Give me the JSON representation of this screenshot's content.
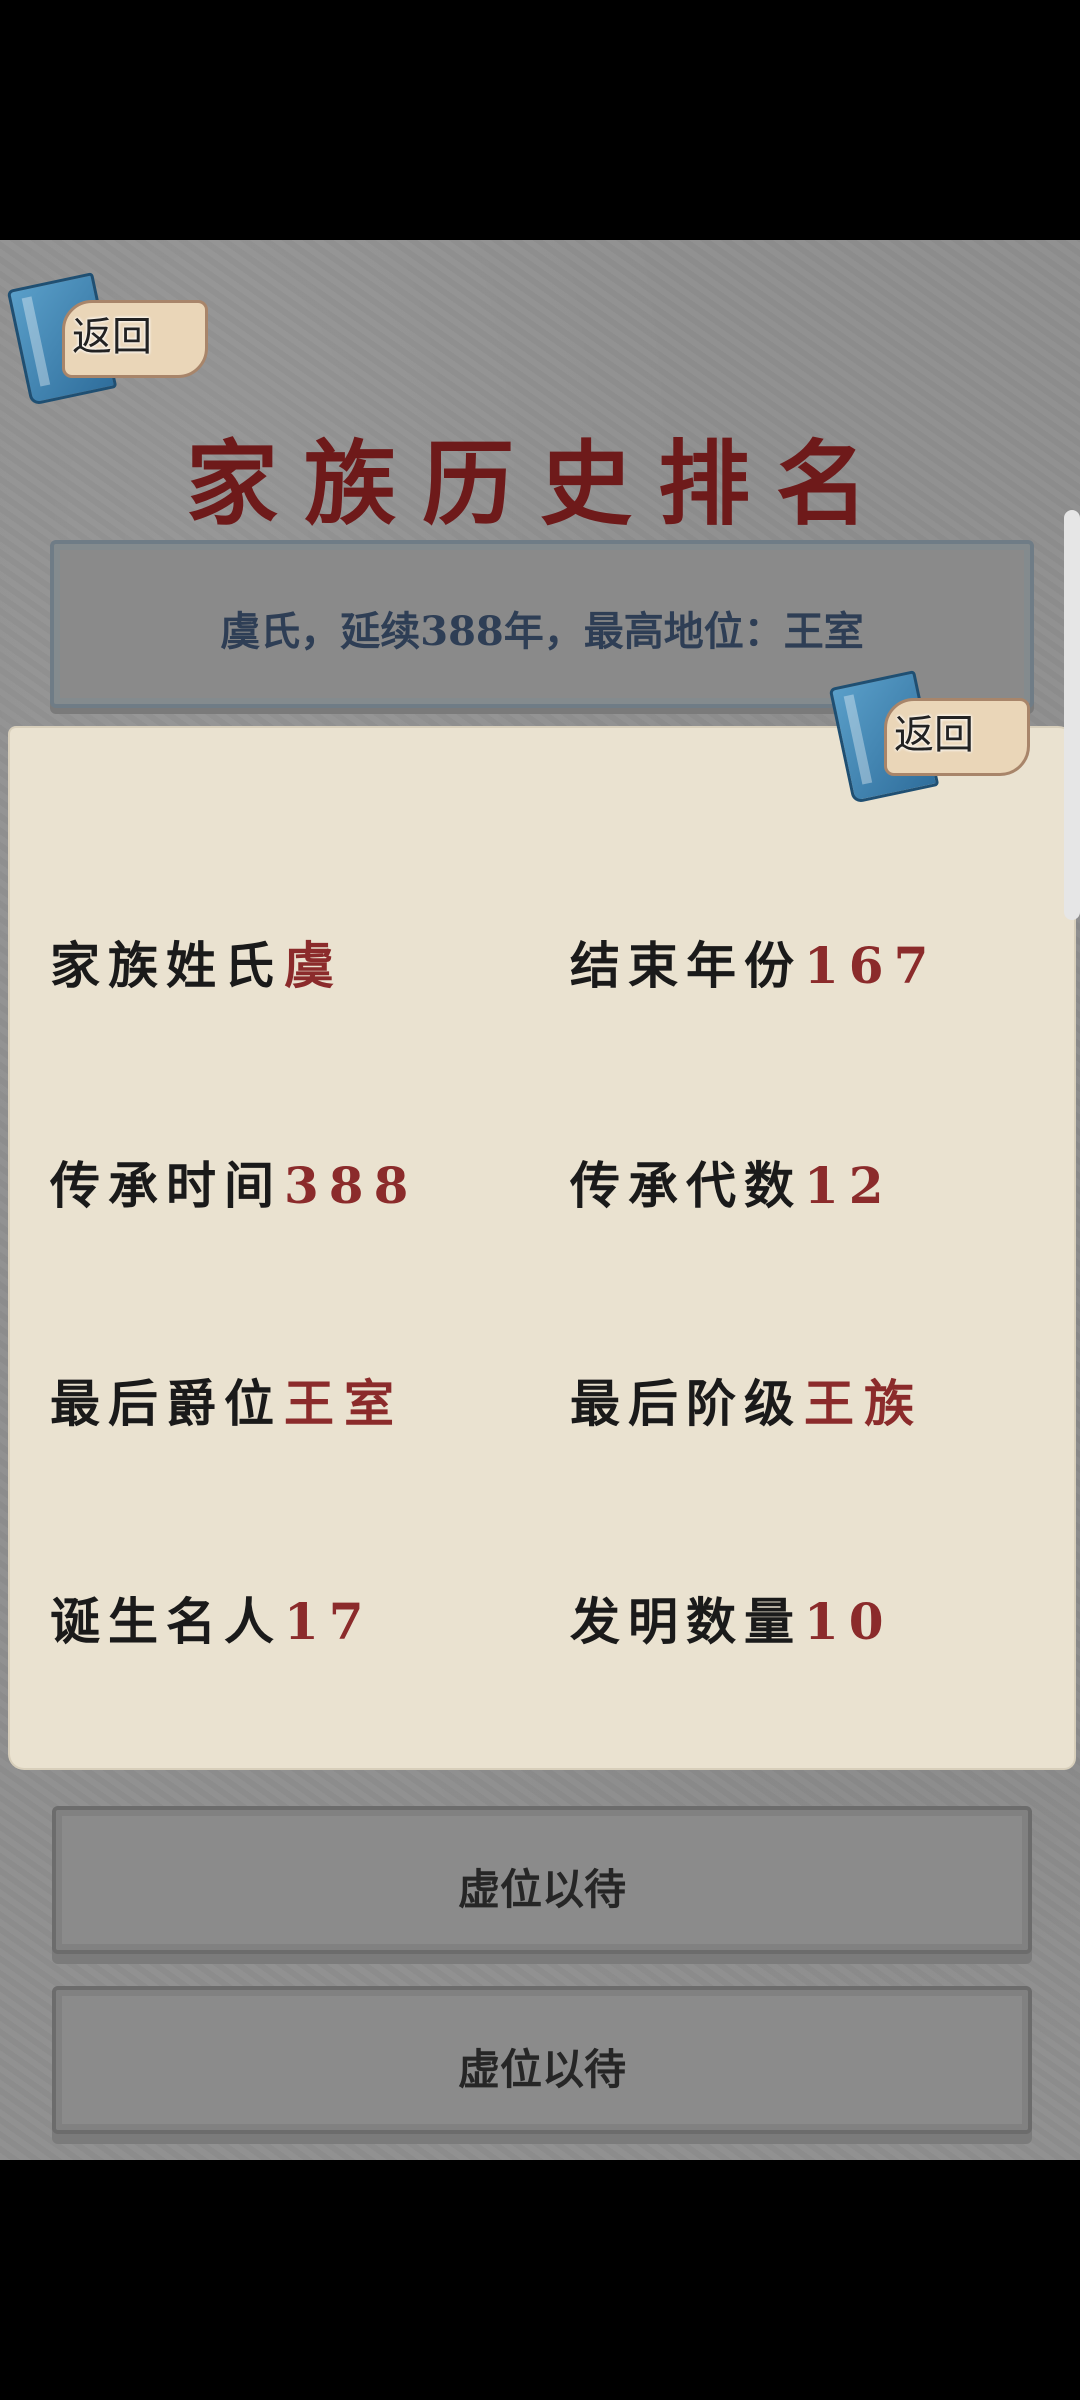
{
  "header": {
    "back_label": "返回",
    "title": "家族历史排名"
  },
  "summary": {
    "text": "虞氏，延续388年，最高地位：王室"
  },
  "detail": {
    "back_label": "返回",
    "stats": [
      {
        "key": "家族姓氏",
        "value": "虞"
      },
      {
        "key": "结束年份",
        "value": "167"
      },
      {
        "key": "传承时间",
        "value": "388"
      },
      {
        "key": "传承代数",
        "value": "12"
      },
      {
        "key": "最后爵位",
        "value": "王室"
      },
      {
        "key": "最后阶级",
        "value": "王族"
      },
      {
        "key": "诞生名人",
        "value": "17"
      },
      {
        "key": "发明数量",
        "value": "10"
      }
    ]
  },
  "ranking": {
    "rows": [
      {
        "label": "虚位以待"
      },
      {
        "label": "虚位以待"
      }
    ]
  },
  "colors": {
    "title": "#6e1a1a",
    "value": "#8b2b2b",
    "summary_text": "#2e3e55",
    "card": "#eae2d0",
    "background": "#8f8f8f"
  }
}
